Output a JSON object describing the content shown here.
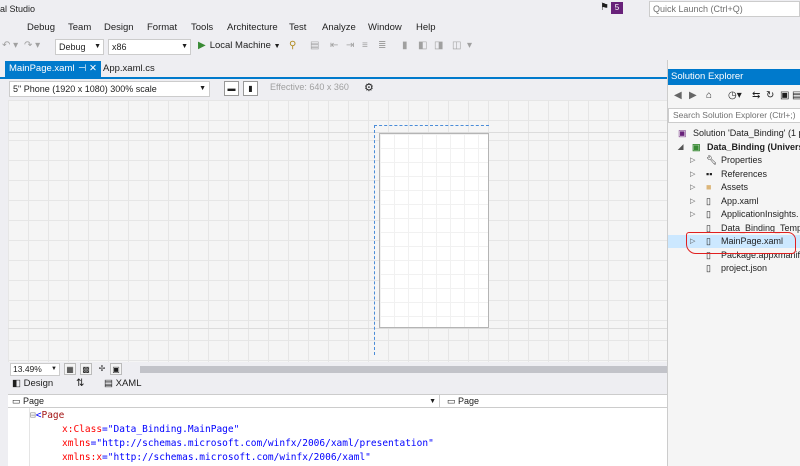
{
  "window": {
    "title": "al Studio",
    "notification_count": "5",
    "quick_launch_placeholder": "Quick Launch (Ctrl+Q)"
  },
  "menu": [
    "Debug",
    "Team",
    "Design",
    "Format",
    "Tools",
    "Architecture",
    "Test",
    "Analyze",
    "Window",
    "Help"
  ],
  "toolbar": {
    "configuration": "Debug",
    "platform": "x86",
    "run_target": "Local Machine"
  },
  "doc_tabs": {
    "active": "MainPage.xaml",
    "inactive": "App.xaml.cs"
  },
  "designer": {
    "device": "5\" Phone (1920 x 1080) 300% scale",
    "effective": "Effective: 640 x 360",
    "zoom": "13.49%"
  },
  "split_tabs": {
    "design": "Design",
    "xaml": "XAML"
  },
  "code_nav": {
    "left": "Page",
    "right": "Page"
  },
  "code": {
    "line1_tag": "Page",
    "line2_attr": "x:Class",
    "line2_val": "\"Data_Binding.MainPage\"",
    "line3_attr": "xmlns",
    "line3_val": "\"http://schemas.microsoft.com/winfx/2006/xaml/presentation\"",
    "line4_attr": "xmlns:x",
    "line4_val": "\"http://schemas.microsoft.com/winfx/2006/xaml\""
  },
  "solution_explorer": {
    "title": "Solution Explorer",
    "search_placeholder": "Search Solution Explorer (Ctrl+;)",
    "items": [
      {
        "label": "Solution 'Data_Binding' (1 p",
        "icon": "solution-icon"
      },
      {
        "label": "Data_Binding (Univers",
        "icon": "csharp-project-icon"
      },
      {
        "label": "Properties",
        "icon": "wrench-icon"
      },
      {
        "label": "References",
        "icon": "references-icon"
      },
      {
        "label": "Assets",
        "icon": "folder-icon"
      },
      {
        "label": "App.xaml",
        "icon": "xaml-file-icon"
      },
      {
        "label": "ApplicationInsights.",
        "icon": "config-file-icon"
      },
      {
        "label": "Data_Binding_Temp",
        "icon": "file-icon"
      },
      {
        "label": "MainPage.xaml",
        "icon": "xaml-file-icon"
      },
      {
        "label": "Package.appxmanife",
        "icon": "manifest-icon"
      },
      {
        "label": "project.json",
        "icon": "json-file-icon"
      }
    ]
  }
}
